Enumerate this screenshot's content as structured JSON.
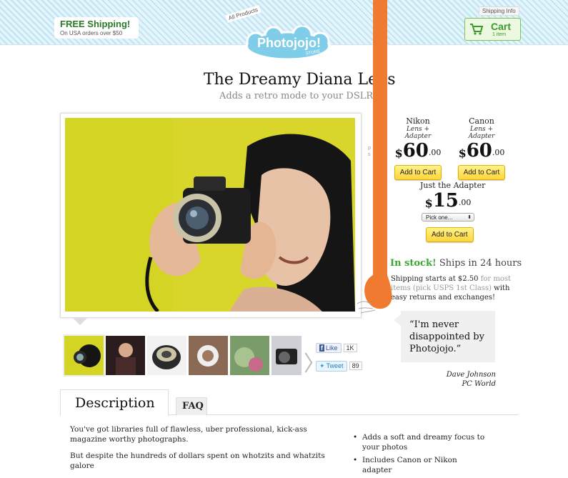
{
  "header": {
    "free_shipping_title": "FREE Shipping!",
    "free_shipping_sub": "On USA orders over $50",
    "all_products": "All Products",
    "logo": "Photojojo!",
    "logo_sub": "STORE",
    "shipping_info": "Shipping Info",
    "cart_label": "Cart",
    "cart_count": "1 item"
  },
  "product": {
    "title": "The Dreamy Diana Lens",
    "subtitle": "Adds a retro mode to your DSLR!"
  },
  "pricing": {
    "options": [
      {
        "brand": "Nikon",
        "kind": "Lens + Adapter",
        "dollars": "60",
        "cents": ".00",
        "button": "Add to Cart"
      },
      {
        "brand": "Canon",
        "kind": "Lens + Adapter",
        "dollars": "60",
        "cents": ".00",
        "button": "Add to Cart"
      }
    ],
    "adapter": {
      "title": "Just the Adapter",
      "dollars": "15",
      "cents": ".00",
      "select": "Pick one...",
      "button": "Add to Cart"
    },
    "currency": "$"
  },
  "stock": {
    "in_stock": "In stock!",
    "ships": " Ships in 24 hours",
    "shipping_a": "Shipping starts at $2.50",
    "shipping_b": " for most items (pick USPS 1st Class)",
    "shipping_c": " with easy returns and exchanges!"
  },
  "social": {
    "like": "Like",
    "like_count": "1K",
    "tweet": "Tweet",
    "tweet_count": "89"
  },
  "quote": {
    "text": "“I'm never disappointed by Photojojo.”",
    "author": "Dave Johnson",
    "source": "PC World"
  },
  "tabs": {
    "description": "Description",
    "faq": "FAQ"
  },
  "description": {
    "p1": "You've got libraries full of flawless, uber professional, kick-ass magazine worthy photographs.",
    "p2": "But despite the hundreds of dollars spent on whotzits and whatzits galore"
  },
  "bullets": [
    "Adds a soft and dreamy focus to your photos",
    "Includes Canon or Nikon adapter"
  ],
  "colors": {
    "accent_green": "#3aa830",
    "button_yellow": "#ffd43b",
    "orange": "#f07a30"
  }
}
